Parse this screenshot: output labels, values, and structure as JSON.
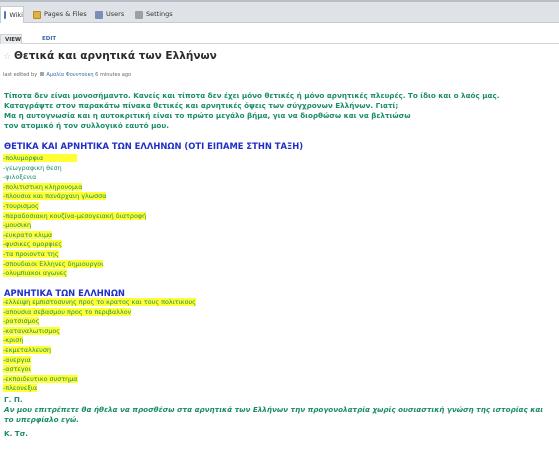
{
  "nav": {
    "tabs": [
      {
        "label": "Wiki",
        "icon": "wiki-icon"
      },
      {
        "label": "Pages & Files",
        "icon": "pages-icon"
      },
      {
        "label": "Users",
        "icon": "users-icon"
      },
      {
        "label": "Settings",
        "icon": "settings-icon"
      }
    ]
  },
  "page": {
    "view_tab": "VIEW",
    "edit_tab": "EDIT",
    "title": "Θετικά και αρνητικά των Ελλήνων",
    "meta_prefix": "last edited by",
    "meta_user": "Αμαλία Φουντούκη",
    "meta_suffix": "6 minutes ago"
  },
  "intro": {
    "line1": "Τίποτα δεν είναι μονοσήμαντο. Κανείς και τίποτα δεν έχει μόνο θετικές ή μόνο αρνητικές πλευρές. Το ίδιο και ο λαός μας.",
    "line2": " Καταγράψτε στον παρακάτω πίνακα θετικές και αρνητικές όψεις των σύγχρονων Ελλήνων. Γιατί;",
    "line3": " Μα η αυτογνωσία και η αυτοκριτική είναι το πρώτο μεγάλο βήμα, για να διορθώσω και να βελτιώσω",
    "line4": "τον ατομικό ή τον συλλογικό εαυτό μου."
  },
  "positives": {
    "heading": "ΘΕΤΙΚΑ ΚΑΙ ΑΡΝΗΤΙΚΑ ΤΩΝ ΕΛΛΗΝΩΝ (ΟΤΙ ΕΙΠΑΜΕ ΣΤΗΝ ΤΑΞΗ)",
    "items": [
      "-πολυμορφια",
      "-γεωγραφικη θεση",
      "-φιλοξενια",
      "-πολιτιστικη κληρονομια",
      "-πλουσια και πανάρχαιη γλωσσα",
      "-τουρισμος",
      "-παραδοσιακη κουζίνα-μεσογειακή διατροφή",
      "-μουσικη",
      "-ευκρατο κλιμα",
      "-φυσικες ομορφιες",
      "-τα προιοντα της",
      "-σπουδαιοι Ελληνες δημιουργοι",
      "-ολυμπιακοι αγωνες"
    ]
  },
  "negatives": {
    "heading": "ΑΡΝΗΤΙΚΑ ΤΩΝ ΕΛΛΗΝΩΝ",
    "items": [
      "-ελλειψη εμπιστοσυνης προς το κρατος και τους πολιτικους",
      "-απουσια σεβασμου προς το περιβαλλον",
      "-ρατσισμος",
      "-καταναλωτισμος",
      "-κριση",
      "-εκμεταλλευση",
      "-ανεργια",
      "-αστεγοι",
      "-εκπαιδευτικο συστημα",
      "-πλεονεξια"
    ]
  },
  "signature1": "Γ. Π.",
  "note": "Αν μου επιτρέπετε θα ήθελα να προσθέσω στα αρνητικά των Ελλήνων την προγονολατρία χωρίς ουσιαστική γνώση της ιστορίας και το υπερφίαλο εγώ.",
  "signature2": "Κ. Τσ."
}
